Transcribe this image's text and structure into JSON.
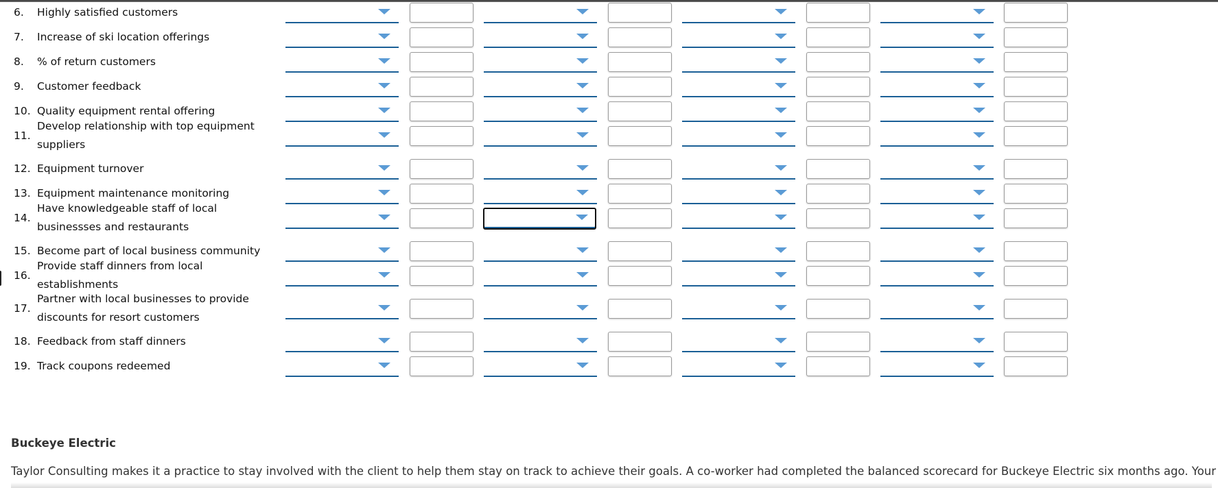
{
  "colors": {
    "dropdown_underline": "#1a5f96",
    "dropdown_arrow": "#5b9bd5",
    "input_border": "#9a9a9a",
    "text": "#111111",
    "section_text": "#333333"
  },
  "table": {
    "column_count": 4,
    "rows": [
      {
        "number": "6.",
        "label": "Highly satisfied customers",
        "two_line": false
      },
      {
        "number": "7.",
        "label": "Increase of ski location offerings",
        "two_line": false
      },
      {
        "number": "8.",
        "label": "% of return customers",
        "two_line": false
      },
      {
        "number": "9.",
        "label": "Customer feedback",
        "two_line": false
      },
      {
        "number": "10.",
        "label": "Quality equipment rental offering",
        "two_line": false
      },
      {
        "number": "11.",
        "label": "Develop relationship with top equipment suppliers",
        "two_line": true
      },
      {
        "number": "12.",
        "label": "Equipment turnover",
        "two_line": false
      },
      {
        "number": "13.",
        "label": "Equipment maintenance monitoring",
        "two_line": false
      },
      {
        "number": "14.",
        "label": "Have knowledgeable staff of local businessses and restaurants",
        "two_line": true,
        "focused_column": 2
      },
      {
        "number": "15.",
        "label": "Become part of local business community",
        "two_line": false
      },
      {
        "number": "16.",
        "label": "Provide staff dinners from local establishments",
        "two_line": true
      },
      {
        "number": "17.",
        "label": "Partner with local businesses to provide discounts for resort customers",
        "two_line": true
      },
      {
        "number": "18.",
        "label": "Feedback from staff dinners",
        "two_line": false
      },
      {
        "number": "19.",
        "label": "Track coupons redeemed",
        "two_line": false
      }
    ],
    "dropdown_value": "",
    "input_value": ""
  },
  "section": {
    "title": "Buckeye Electric",
    "paragraph": "Taylor Consulting makes it a practice to stay involved with the client to help them stay on track to achieve their goals. A co-worker had completed the balanced scorecard for Buckeye Electric six months ago. Your manager"
  }
}
